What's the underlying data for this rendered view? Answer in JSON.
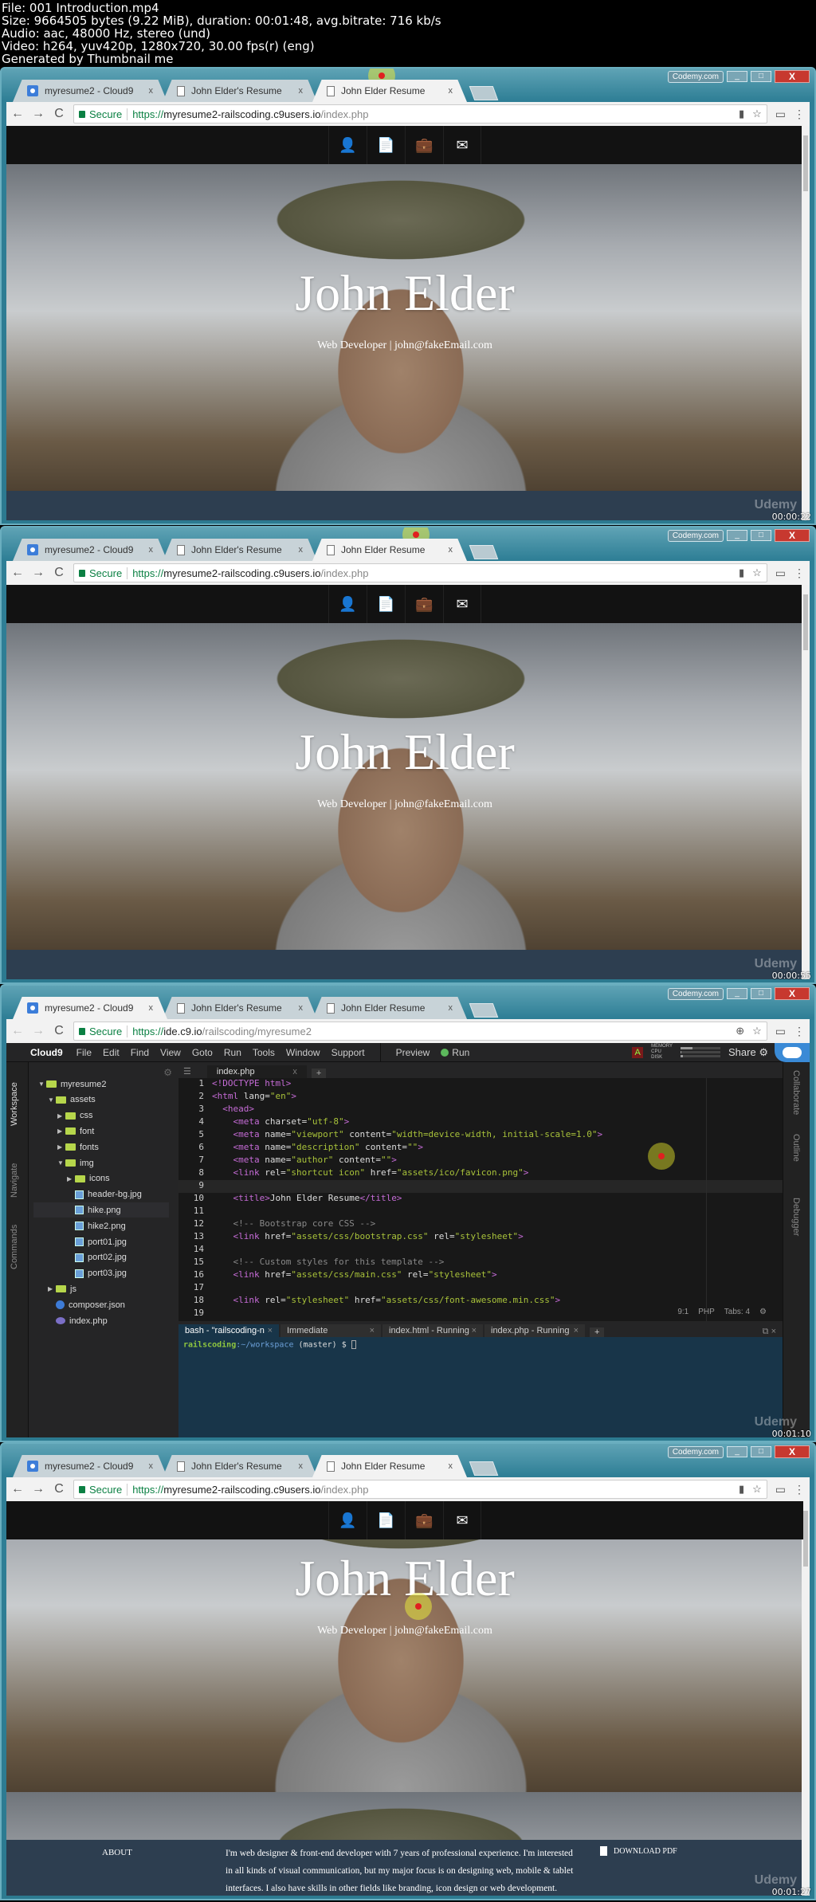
{
  "file_info": {
    "lines": [
      "File: 001 Introduction.mp4",
      "Size: 9664505 bytes (9.22 MiB), duration: 00:01:48, avg.bitrate: 716 kb/s",
      "Audio: aac, 48000 Hz, stereo (und)",
      "Video: h264, yuv420p, 1280x720, 30.00 fps(r) (eng)",
      "Generated by Thumbnail me"
    ]
  },
  "window": {
    "codemy_label": "Codemy.com",
    "minimize": "_",
    "maximize": "□",
    "close": "X"
  },
  "tabs": [
    {
      "label": "myresume2 - Cloud9",
      "icon": "cloud9-icon"
    },
    {
      "label": "John Elder's Resume",
      "icon": "page-icon"
    },
    {
      "label": "John Elder Resume",
      "icon": "page-icon"
    }
  ],
  "tab_close": "x",
  "address": {
    "secure_label": "Secure",
    "site": {
      "proto": "https://",
      "host": "myresume2-railscoding.c9users.io",
      "path": "/index.php"
    },
    "ide": {
      "proto": "https://",
      "host": "ide.c9.io",
      "path": "/railscoding/myresume2"
    }
  },
  "nav_icons": {
    "back": "←",
    "forward": "→",
    "reload": "C",
    "star": "☆",
    "menu": "⋮",
    "cast": "▭",
    "zoom": "⊕"
  },
  "site": {
    "nav_icons": [
      "user-icon",
      "file-icon",
      "briefcase-icon",
      "envelope-icon"
    ],
    "nav_glyphs": [
      "👤",
      "📄",
      "💼",
      "✉"
    ],
    "title": "John Elder",
    "subtitle": "Web Developer | john@fakeEmail.com",
    "about": {
      "heading": "ABOUT",
      "text": "I'm web designer & front-end developer with 7 years of professional experience. I'm interested in all kinds of visual communication, but my major focus is on designing web, mobile & tablet interfaces. I also have skills in other fields like branding, icon design or web development.",
      "download": "DOWNLOAD PDF"
    }
  },
  "frames": [
    {
      "timestamp": "00:00:22",
      "active_tab": 2
    },
    {
      "timestamp": "00:00:55",
      "active_tab": 2
    },
    {
      "timestamp": "00:01:10",
      "active_tab": 0
    },
    {
      "timestamp": "00:01:27",
      "active_tab": 2
    }
  ],
  "watermark": "Udemy",
  "ide": {
    "brand": "Cloud9",
    "menu": [
      "File",
      "Edit",
      "Find",
      "View",
      "Goto",
      "Run",
      "Tools",
      "Window",
      "Support"
    ],
    "preview": "Preview",
    "run": "Run",
    "meters": [
      {
        "label": "MEMORY",
        "value": 0.3
      },
      {
        "label": "CPU",
        "value": 0.02
      },
      {
        "label": "DISK",
        "value": 0.05
      }
    ],
    "share": "Share",
    "left_rail": [
      "Workspace",
      "Navigate",
      "Commands"
    ],
    "right_rail": [
      "Collaborate",
      "Outline",
      "Debugger"
    ],
    "tree": [
      {
        "label": "myresume2",
        "type": "folder",
        "depth": 0,
        "open": true
      },
      {
        "label": "assets",
        "type": "folder",
        "depth": 1,
        "open": true
      },
      {
        "label": "css",
        "type": "folder",
        "depth": 2,
        "open": false
      },
      {
        "label": "font",
        "type": "folder",
        "depth": 2,
        "open": false
      },
      {
        "label": "fonts",
        "type": "folder",
        "depth": 2,
        "open": false
      },
      {
        "label": "img",
        "type": "folder",
        "depth": 2,
        "open": true
      },
      {
        "label": "icons",
        "type": "folder",
        "depth": 3,
        "open": false
      },
      {
        "label": "header-bg.jpg",
        "type": "image",
        "depth": 3
      },
      {
        "label": "hike.png",
        "type": "image",
        "depth": 3,
        "selected": true
      },
      {
        "label": "hike2.png",
        "type": "image",
        "depth": 3
      },
      {
        "label": "port01.jpg",
        "type": "image",
        "depth": 3
      },
      {
        "label": "port02.jpg",
        "type": "image",
        "depth": 3
      },
      {
        "label": "port03.jpg",
        "type": "image",
        "depth": 3
      },
      {
        "label": "js",
        "type": "folder",
        "depth": 1,
        "open": false
      },
      {
        "label": "composer.json",
        "type": "json",
        "depth": 1
      },
      {
        "label": "index.php",
        "type": "php",
        "depth": 1
      }
    ],
    "editor_tab": "index.php",
    "code": [
      [
        {
          "c": "tg",
          "t": "<!DOCTYPE html>"
        }
      ],
      [
        {
          "c": "tg",
          "t": "<html "
        },
        {
          "c": "at",
          "t": "lang="
        },
        {
          "c": "sv",
          "t": "\"en\""
        },
        {
          "c": "tg",
          "t": ">"
        }
      ],
      [
        {
          "c": "tg",
          "t": "  <head>"
        }
      ],
      [
        {
          "c": "tg",
          "t": "    <meta "
        },
        {
          "c": "at",
          "t": "charset="
        },
        {
          "c": "sv",
          "t": "\"utf-8\""
        },
        {
          "c": "tg",
          "t": ">"
        }
      ],
      [
        {
          "c": "tg",
          "t": "    <meta "
        },
        {
          "c": "at",
          "t": "name="
        },
        {
          "c": "sv",
          "t": "\"viewport\""
        },
        {
          "c": "at",
          "t": " content="
        },
        {
          "c": "sv",
          "t": "\"width=device-width, initial-scale=1.0\""
        },
        {
          "c": "tg",
          "t": ">"
        }
      ],
      [
        {
          "c": "tg",
          "t": "    <meta "
        },
        {
          "c": "at",
          "t": "name="
        },
        {
          "c": "sv",
          "t": "\"description\""
        },
        {
          "c": "at",
          "t": " content="
        },
        {
          "c": "sv",
          "t": "\"\""
        },
        {
          "c": "tg",
          "t": ">"
        }
      ],
      [
        {
          "c": "tg",
          "t": "    <meta "
        },
        {
          "c": "at",
          "t": "name="
        },
        {
          "c": "sv",
          "t": "\"author\""
        },
        {
          "c": "at",
          "t": " content="
        },
        {
          "c": "sv",
          "t": "\"\""
        },
        {
          "c": "tg",
          "t": ">"
        }
      ],
      [
        {
          "c": "tg",
          "t": "    <link "
        },
        {
          "c": "at",
          "t": "rel="
        },
        {
          "c": "sv",
          "t": "\"shortcut icon\""
        },
        {
          "c": "at",
          "t": " href="
        },
        {
          "c": "sv",
          "t": "\"assets/ico/favicon.png\""
        },
        {
          "c": "tg",
          "t": ">"
        }
      ],
      [],
      [
        {
          "c": "tg",
          "t": "    <title>"
        },
        {
          "c": "at",
          "t": "John Elder Resume"
        },
        {
          "c": "tg",
          "t": "</title>"
        }
      ],
      [],
      [
        {
          "c": "cm",
          "t": "    <!-- Bootstrap core CSS -->"
        }
      ],
      [
        {
          "c": "tg",
          "t": "    <link "
        },
        {
          "c": "at",
          "t": "href="
        },
        {
          "c": "sv",
          "t": "\"assets/css/bootstrap.css\""
        },
        {
          "c": "at",
          "t": " rel="
        },
        {
          "c": "sv",
          "t": "\"stylesheet\""
        },
        {
          "c": "tg",
          "t": ">"
        }
      ],
      [],
      [
        {
          "c": "cm",
          "t": "    <!-- Custom styles for this template -->"
        }
      ],
      [
        {
          "c": "tg",
          "t": "    <link "
        },
        {
          "c": "at",
          "t": "href="
        },
        {
          "c": "sv",
          "t": "\"assets/css/main.css\""
        },
        {
          "c": "at",
          "t": " rel="
        },
        {
          "c": "sv",
          "t": "\"stylesheet\""
        },
        {
          "c": "tg",
          "t": ">"
        }
      ],
      [],
      [
        {
          "c": "tg",
          "t": "    <link "
        },
        {
          "c": "at",
          "t": "rel="
        },
        {
          "c": "sv",
          "t": "\"stylesheet\""
        },
        {
          "c": "at",
          "t": " href="
        },
        {
          "c": "sv",
          "t": "\"assets/css/font-awesome.min.css\""
        },
        {
          "c": "tg",
          "t": ">"
        }
      ],
      []
    ],
    "current_line": 9,
    "status": {
      "position": "9:1",
      "mode": "PHP",
      "tabs": "Tabs: 4"
    },
    "terminal_tabs": [
      {
        "label": "bash - \"railscoding-n",
        "active": true
      },
      {
        "label": "Immediate",
        "active": false
      },
      {
        "label": "index.html - Running",
        "active": false
      },
      {
        "label": "index.php - Running",
        "active": false
      }
    ],
    "prompt": {
      "user": "railscoding",
      "path": ":~/workspace",
      "branch": " (master) $ "
    }
  }
}
